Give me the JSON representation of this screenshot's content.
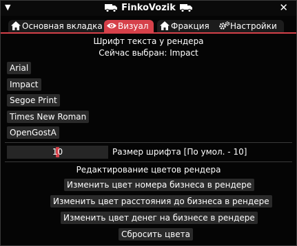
{
  "window": {
    "title": "FinkoVozik",
    "close_label": "✕"
  },
  "tabs": [
    {
      "label": "Основная вкладка",
      "icon": "home-icon"
    },
    {
      "label": "Визуал",
      "icon": "eye-icon",
      "active": true
    },
    {
      "label": "Фракция",
      "icon": "home-icon"
    },
    {
      "label": "Настройки",
      "icon": "gears-icon"
    }
  ],
  "font_section": {
    "heading": "Шрифт текста у рендера",
    "current": "Сейчас выбран: Impact",
    "fonts": [
      "Arial",
      "Impact",
      "Segoe Print",
      "Times New Roman",
      "OpenGostA"
    ]
  },
  "font_size": {
    "value": "10",
    "fraction": 0.5,
    "label": "Размер шрифта [По умол. - 10]"
  },
  "colors_section": {
    "heading": "Редактирование цветов рендера",
    "buttons": [
      "Изменить цвет номера бизнеса в рендере",
      "Изменить цвет расстояния до бизнеса в рендере",
      "Изменить цвет денег на бизнесе в рендере",
      "Сбросить цвета"
    ]
  },
  "colors": {
    "accent": "#d6414a",
    "background": "#050505",
    "button": "#2a2a2a"
  }
}
